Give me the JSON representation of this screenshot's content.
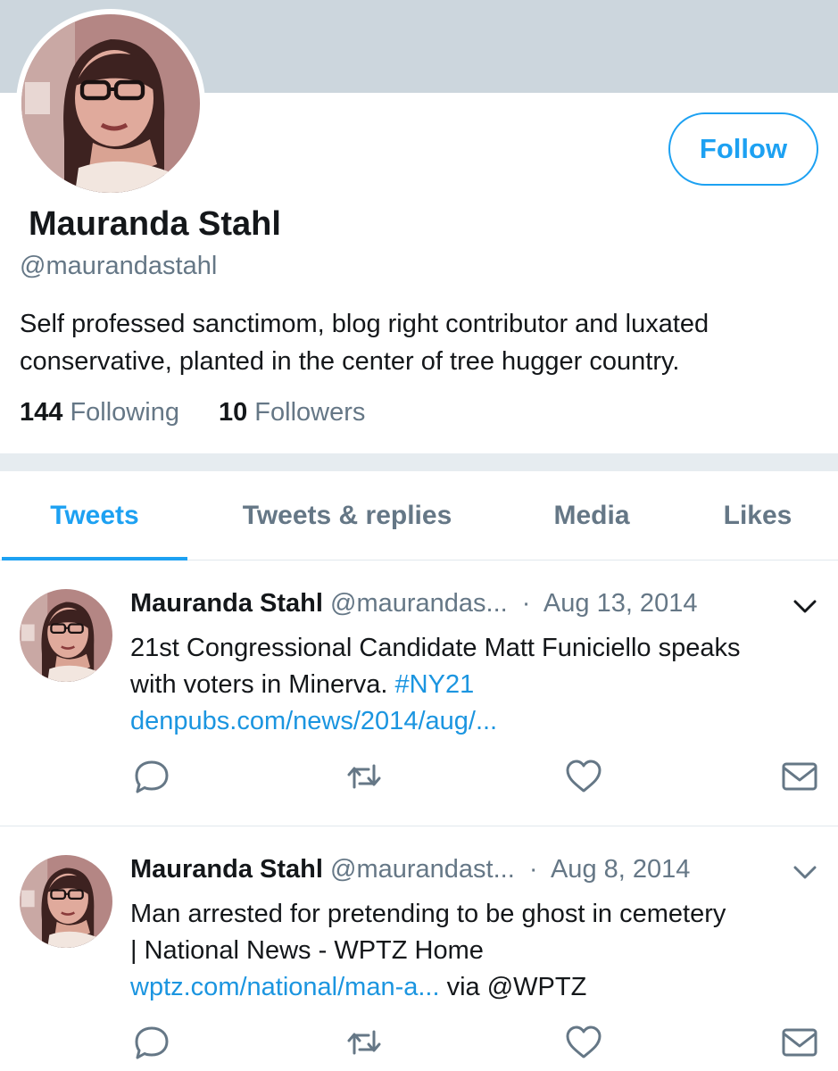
{
  "profile": {
    "display_name": "Mauranda Stahl",
    "handle": "@maurandastahl",
    "bio": "Self professed sanctimom, blog right contributor and luxated conservative, planted in the center of tree hugger country.",
    "following_count": "144",
    "following_label": "Following",
    "followers_count": "10",
    "followers_label": "Followers",
    "follow_button": "Follow"
  },
  "tabs": [
    {
      "label": "Tweets",
      "active": true
    },
    {
      "label": "Tweets & replies",
      "active": false
    },
    {
      "label": "Media",
      "active": false
    },
    {
      "label": "Likes",
      "active": false
    }
  ],
  "tweets": [
    {
      "name": "Mauranda Stahl",
      "handle": "@maurandas...",
      "separator": "·",
      "date": "Aug 13, 2014",
      "text_line1": "21st Congressional Candidate Matt Funiciello speaks",
      "text_line2_plain": "with voters in Minerva. ",
      "hashtag": "#NY21",
      "link": "denpubs.com/news/2014/aug/..."
    },
    {
      "name": "Mauranda Stahl",
      "handle": "@maurandast...",
      "separator": "·",
      "date": "Aug 8, 2014",
      "text_line1": "Man arrested for pretending to be ghost in cemetery",
      "text_line2_plain": "| National News - WPTZ Home",
      "link": "wptz.com/national/man-a...",
      "via": " via @WPTZ"
    }
  ],
  "icons": {
    "reply": "reply-icon",
    "retweet": "retweet-icon",
    "like": "heart-icon",
    "message": "envelope-icon",
    "menu": "chevron-down-icon"
  },
  "colors": {
    "accent": "#1da1f2",
    "link": "#1b95e0",
    "secondary_text": "#657786",
    "banner": "#ccd6dd",
    "divider": "#e6ecf0"
  }
}
